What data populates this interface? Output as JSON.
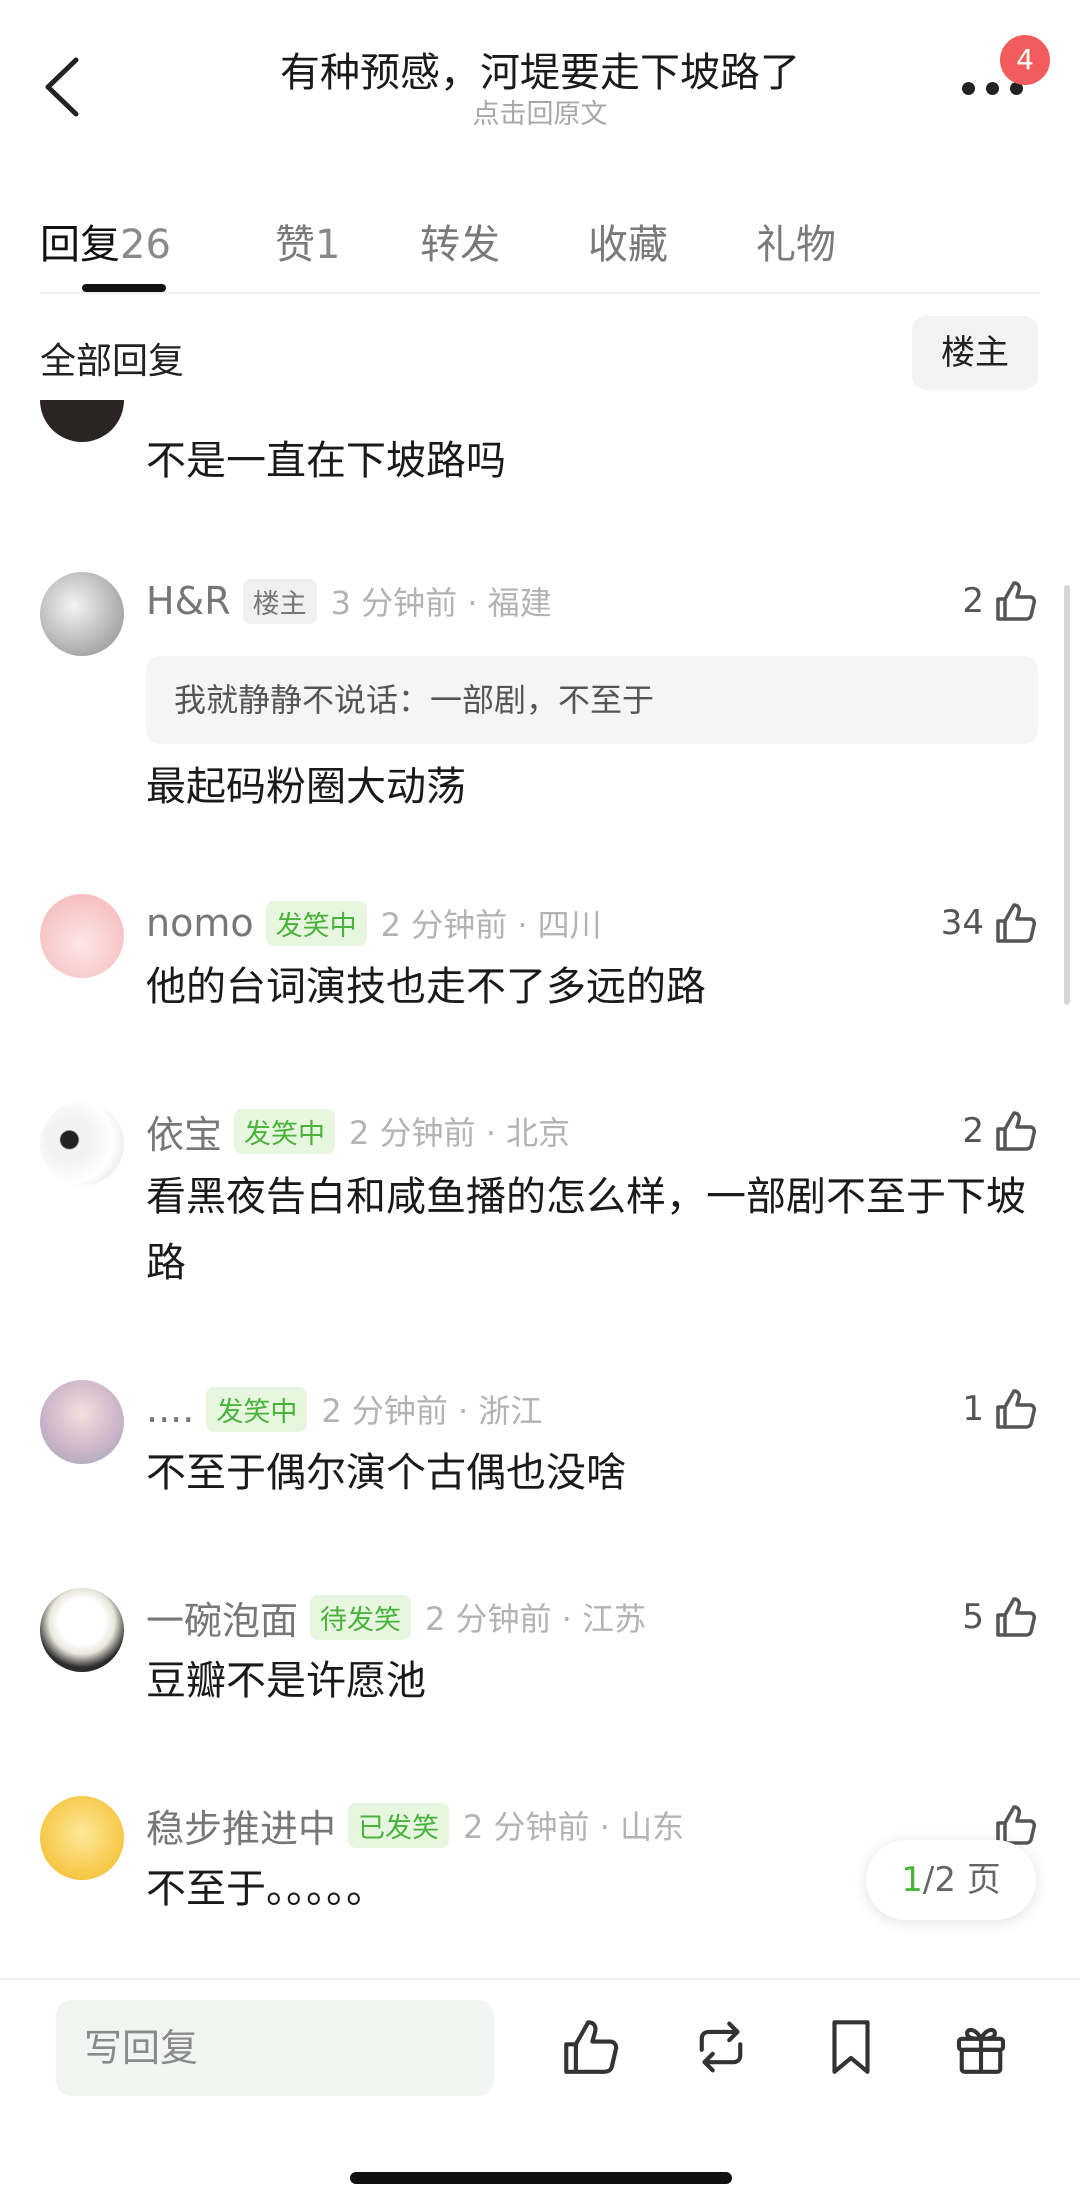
{
  "header": {
    "title": "有种预感，河堤要走下坡路了",
    "subtitle": "点击回原文",
    "badge_count": "4",
    "icons": {
      "back": "chevron-left-icon",
      "more": "more-dots-icon"
    }
  },
  "tabs": [
    {
      "label": "回复",
      "count": "26",
      "active": true
    },
    {
      "label": "赞",
      "count": "1"
    },
    {
      "label": "转发",
      "count": ""
    },
    {
      "label": "收藏",
      "count": ""
    },
    {
      "label": "礼物",
      "count": ""
    }
  ],
  "filter": {
    "all_label": "全部回复",
    "owner_label": "楼主"
  },
  "comments": [
    {
      "text": "不是一直在下坡路吗"
    },
    {
      "name": "H&R",
      "tag": "楼主",
      "time": "3 分钟前 · 福建",
      "likes": "2",
      "quote": "我就静静不说话：一部剧，不至于",
      "text": "最起码粉圈大动荡"
    },
    {
      "name": "nomo",
      "tag": "发笑中",
      "time": "2 分钟前 · 四川",
      "likes": "34",
      "text": "他的台词演技也走不了多远的路"
    },
    {
      "name": "依宝",
      "tag": "发笑中",
      "time": "2 分钟前 · 北京",
      "likes": "2",
      "text": "看黑夜告白和咸鱼播的怎么样，一部剧不至于下坡路"
    },
    {
      "name": "....",
      "tag": "发笑中",
      "time": "2 分钟前 · 浙江",
      "likes": "1",
      "text": "不至于偶尔演个古偶也没啥"
    },
    {
      "name": "一碗泡面",
      "tag": "待发笑",
      "time": "2 分钟前 · 江苏",
      "likes": "5",
      "text": "豆瓣不是许愿池"
    },
    {
      "name": "稳步推进中",
      "tag": "已发笑",
      "time": "2 分钟前 · 山东",
      "likes": "",
      "text": "不至于。。。。。"
    }
  ],
  "pager": {
    "current": "1",
    "total": "/2 页"
  },
  "bottom_bar": {
    "reply_placeholder": "写回复",
    "icons": [
      "like-icon",
      "repost-icon",
      "bookmark-icon",
      "gift-icon"
    ]
  },
  "colors": {
    "accent_green": "#49b33b",
    "badge_red": "#f25c5c",
    "tag_green_bg": "#e6f6df"
  }
}
